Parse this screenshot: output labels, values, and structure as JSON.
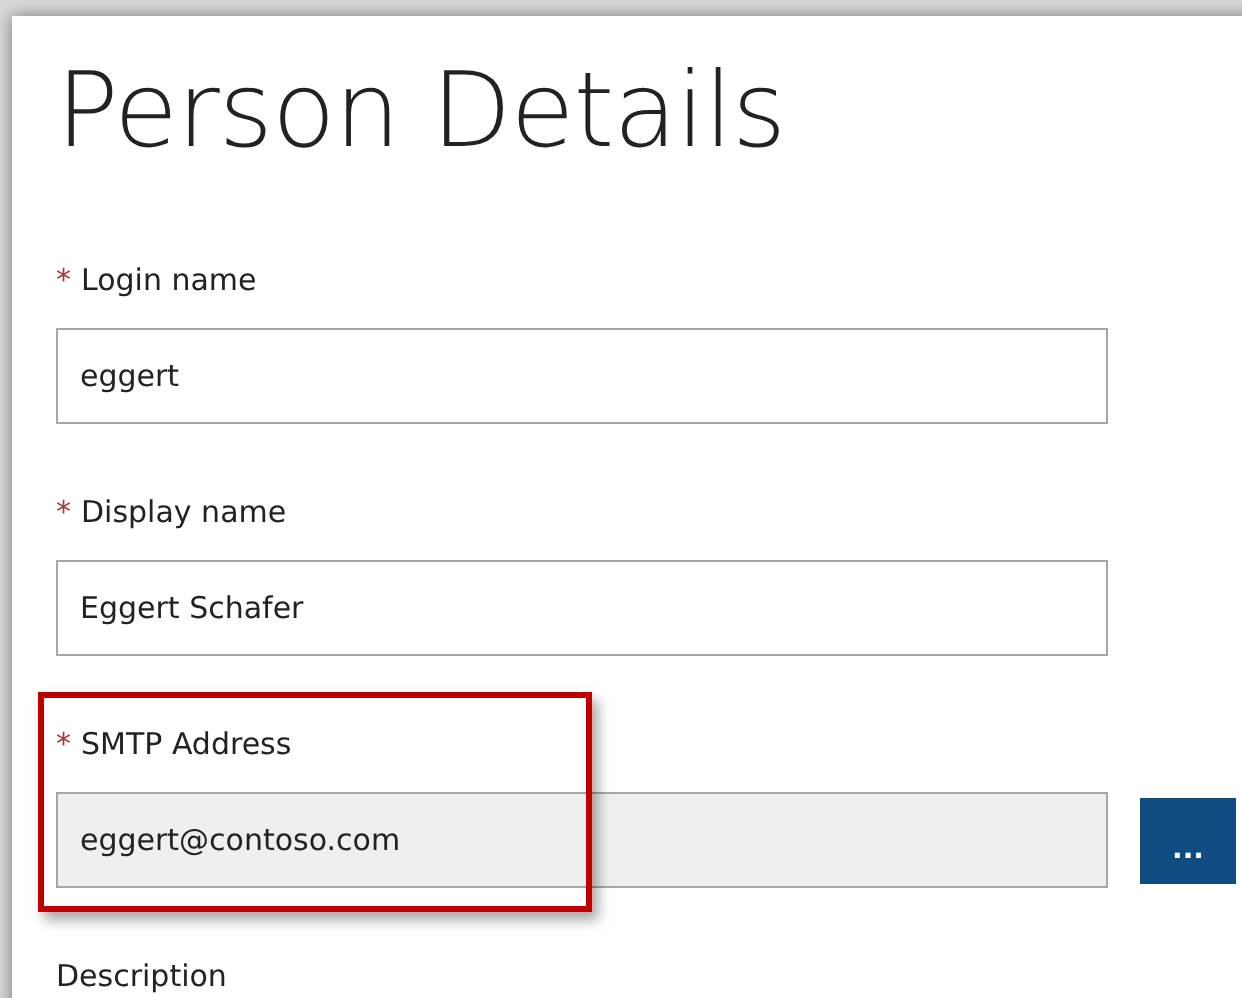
{
  "title": "Person Details",
  "fields": [
    {
      "label": "Login name",
      "marker": "*",
      "value": "eggert",
      "disabled": false,
      "highlighted": false
    },
    {
      "label": "Display name",
      "marker": "*",
      "value": "Eggert Schafer",
      "disabled": false,
      "highlighted": false
    },
    {
      "label": "SMTP Address",
      "marker": "*",
      "value": "eggert@contoso.com",
      "disabled": true,
      "highlighted": true,
      "button": "..."
    },
    {
      "label": "Description",
      "highlighted": false
    }
  ]
}
